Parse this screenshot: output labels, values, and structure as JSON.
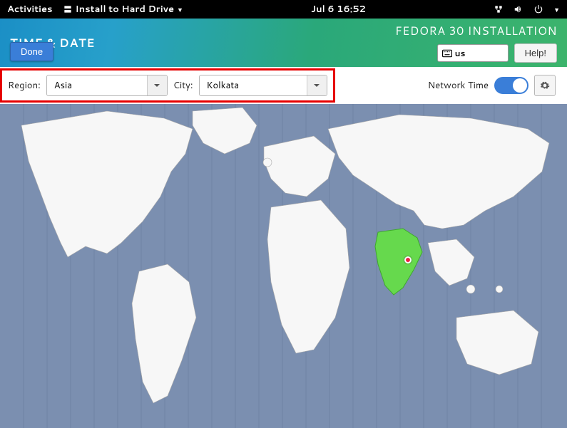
{
  "topbar": {
    "activities": "Activities",
    "app_name": "Install to Hard Drive",
    "clock": "Jul 6  16:52"
  },
  "header": {
    "title": "TIME & DATE",
    "done": "Done",
    "installer_title": "FEDORA 30 INSTALLATION",
    "kb_layout": "us",
    "help": "Help!"
  },
  "controls": {
    "region_label": "Region:",
    "region_value": "Asia",
    "city_label": "City:",
    "city_value": "Kolkata",
    "network_time_label": "Network Time",
    "network_time_on": true
  },
  "map": {
    "selected_region": "India",
    "selected_city": "Kolkata"
  }
}
